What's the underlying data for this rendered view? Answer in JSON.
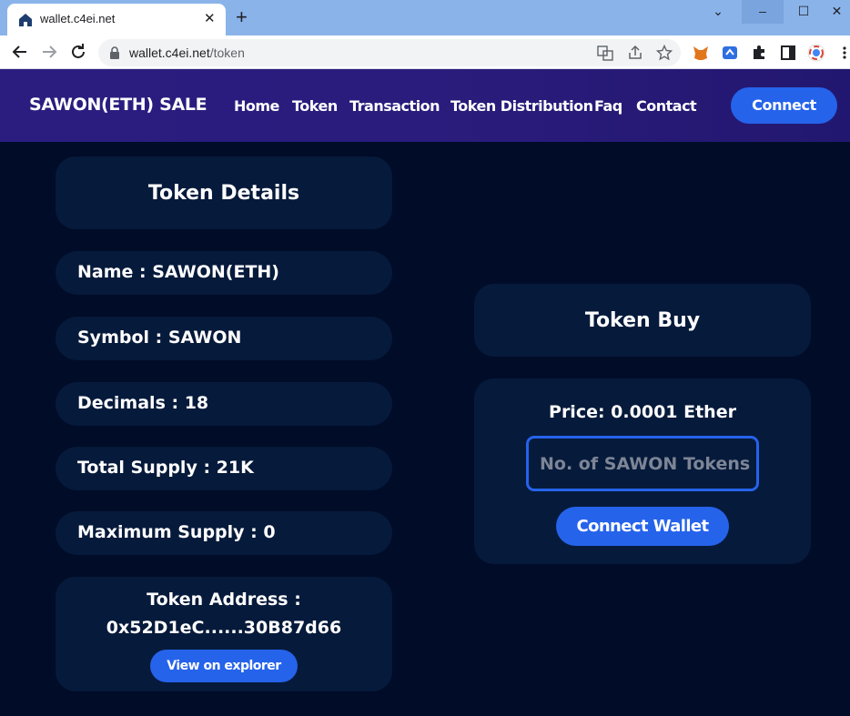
{
  "browser": {
    "tab_title": "wallet.c4ei.net",
    "tab_close": "✕",
    "new_tab": "+",
    "url_host": "wallet.c4ei.net",
    "url_path": "/token",
    "window_controls": {
      "chevron": "⌄",
      "minimize": "–",
      "maximize": "☐",
      "close": "✕"
    }
  },
  "header": {
    "brand": "SAWON(ETH) SALE",
    "nav": [
      "Home",
      "Token",
      "Transaction",
      "Token Distribution",
      "Faq",
      "Contact"
    ],
    "connect_label": "Connect"
  },
  "token_details": {
    "title": "Token Details",
    "name": "Name : SAWON(ETH)",
    "symbol": "Symbol : SAWON",
    "decimals": "Decimals : 18",
    "total_supply": "Total Supply : 21K",
    "maximum_supply": "Maximum Supply : 0",
    "address_label": "Token Address :",
    "address_value": "0x52D1eC......30B87d66",
    "explorer_label": "View on explorer"
  },
  "token_buy": {
    "title": "Token Buy",
    "price": "Price: 0.0001 Ether",
    "input_placeholder": "No. of SAWON Tokens",
    "connect_wallet_label": "Connect Wallet"
  },
  "colors": {
    "page_bg": "#010c28",
    "card_bg": "#061a3b",
    "accent": "#2563eb",
    "header_bg": "#2b1d80"
  }
}
